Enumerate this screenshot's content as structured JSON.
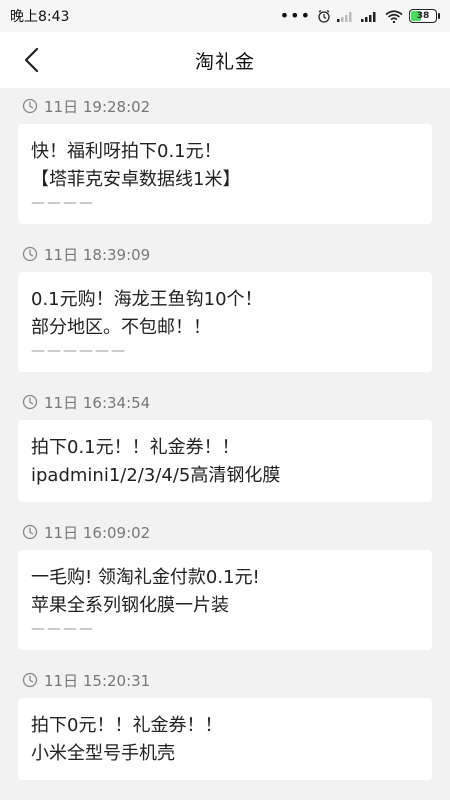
{
  "status_bar": {
    "time": "晚上8:43",
    "battery": "38"
  },
  "header": {
    "title": "淘礼金"
  },
  "icons": {
    "back": "chevron-left-icon",
    "clock": "clock-icon",
    "alarm": "alarm-icon",
    "signal": "signal-icon",
    "wifi": "wifi-icon",
    "battery": "battery-icon"
  },
  "colors": {
    "background": "#f2f2f2",
    "battery_green": "#4cd964"
  },
  "entries": [
    {
      "time": "11日 19:28:02",
      "lines": [
        "快！福利呀拍下0.1元！",
        "【塔菲克安卓数据线1米】"
      ],
      "dash": "————"
    },
    {
      "time": "11日 18:39:09",
      "lines": [
        "0.1元购！海龙王鱼钩10个！",
        "部分地区。不包邮！！"
      ],
      "dash": "——————"
    },
    {
      "time": "11日 16:34:54",
      "lines": [
        "拍下0.1元！！礼金券！！",
        "ipadmini1/2/3/4/5高清钢化膜"
      ],
      "dash": ""
    },
    {
      "time": "11日 16:09:02",
      "lines": [
        "一毛购! 领淘礼金付款0.1元!",
        "苹果全系列钢化膜一片装"
      ],
      "dash": "————"
    },
    {
      "time": "11日 15:20:31",
      "lines": [
        "拍下0元！！礼金券！！",
        "小米全型号手机壳"
      ],
      "dash": ""
    }
  ]
}
